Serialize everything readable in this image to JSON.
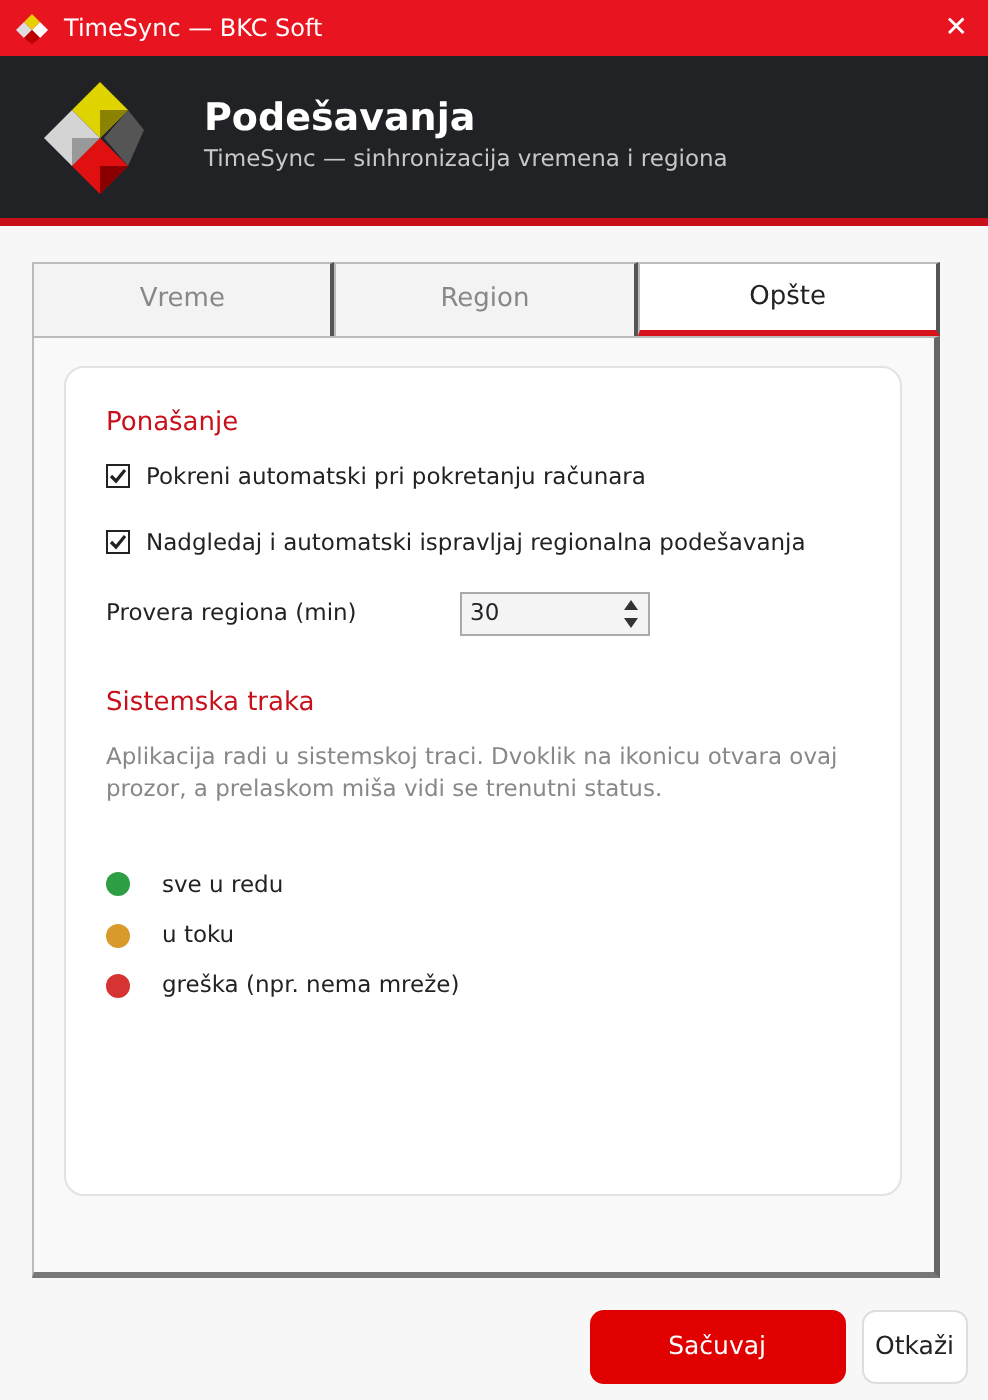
{
  "window": {
    "title": "TimeSync — BKC Soft",
    "close": "✕"
  },
  "header": {
    "title": "Podešavanja",
    "subtitle": "TimeSync — sinhronizacija vremena i regiona"
  },
  "tabs": [
    {
      "label": "Vreme",
      "selected": false
    },
    {
      "label": "Region",
      "selected": false
    },
    {
      "label": "Opšte",
      "selected": true
    }
  ],
  "behavior": {
    "heading": "Ponašanje",
    "options": [
      {
        "label": "Pokreni automatski pri pokretanju računara",
        "checked": true
      },
      {
        "label": "Nadgledaj i automatski ispravljaj regionalna podešavanja",
        "checked": true
      }
    ],
    "interval": {
      "label": "Provera regiona (min)",
      "value": "30"
    }
  },
  "tray": {
    "heading": "Sistemska traka",
    "description": "Aplikacija radi u sistemskoj traci. Dvoklik na ikonicu otvara ovaj prozor, a prelaskom miša vidi se trenutni status.",
    "legend": [
      {
        "label": "sve u redu",
        "color": "#2e9e44"
      },
      {
        "label": "u toku",
        "color": "#d89a2a"
      },
      {
        "label": "greška (npr. nema mreže)",
        "color": "#d63333"
      }
    ]
  },
  "buttons": [
    {
      "label": "Sačuvaj",
      "kind": "primary"
    },
    {
      "label": "Otkaži",
      "kind": "secondary"
    }
  ]
}
